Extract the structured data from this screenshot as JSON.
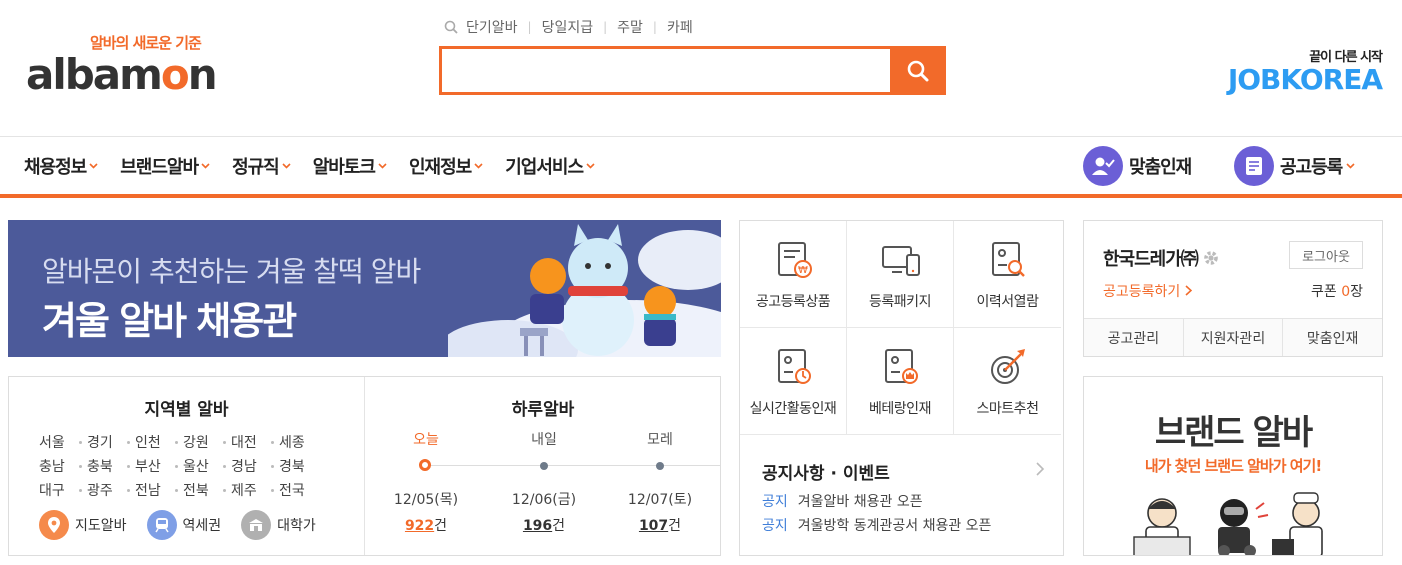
{
  "header": {
    "logo_slogan": "알바의 새로운 기준",
    "logo_text": "albamon",
    "quick_links": [
      "단기알바",
      "당일지급",
      "주말",
      "카페"
    ],
    "search_placeholder": "",
    "jobkorea_slogan": "끝이 다른 시작",
    "jobkorea_text": "JOBKOREA"
  },
  "nav": {
    "items": [
      "채용정보",
      "브랜드알바",
      "정규직",
      "알바토크",
      "인재정보",
      "기업서비스"
    ],
    "matching": "맞춤인재",
    "post": "공고등록"
  },
  "banner": {
    "subtitle": "알바몬이 추천하는 겨울 찰떡 알바",
    "title": "겨울 알바 채용관"
  },
  "region": {
    "title": "지역별 알바",
    "rows": [
      [
        "서울",
        "경기",
        "인천",
        "강원",
        "대전",
        "세종"
      ],
      [
        "충남",
        "충북",
        "부산",
        "울산",
        "경남",
        "경북"
      ],
      [
        "대구",
        "광주",
        "전남",
        "전북",
        "제주",
        "전국"
      ]
    ],
    "links": [
      "지도알바",
      "역세권",
      "대학가"
    ]
  },
  "daily": {
    "title": "하루알바",
    "days": [
      {
        "label": "오늘",
        "date": "12/05(목)",
        "count": "922",
        "unit": "건"
      },
      {
        "label": "내일",
        "date": "12/06(금)",
        "count": "196",
        "unit": "건"
      },
      {
        "label": "모레",
        "date": "12/07(토)",
        "count": "107",
        "unit": "건"
      }
    ]
  },
  "services": {
    "items": [
      "공고등록상품",
      "등록패키지",
      "이력서열람",
      "실시간활동인재",
      "베테랑인재",
      "스마트추천"
    ],
    "notice_title": "공지사항 · 이벤트",
    "notices": [
      {
        "tag": "공지",
        "text": "겨울알바 채용관 오픈"
      },
      {
        "tag": "공지",
        "text": "겨울방학 동계관공서 채용관 오픈"
      }
    ]
  },
  "login": {
    "company": "한국드레가㈜",
    "logout": "로그아웃",
    "post_link": "공고등록하기",
    "coupon_label": "쿠폰",
    "coupon_count": "0",
    "coupon_unit": "장",
    "tabs": [
      "공고관리",
      "지원자관리",
      "맞춤인재"
    ]
  },
  "brand": {
    "title": "브랜드 알바",
    "subtitle": "내가 찾던 브랜드 알바가 여기!"
  },
  "colors": {
    "accent": "#f26a2a",
    "banner_bg": "#4c5a9a",
    "jobkorea": "#2d9cf2",
    "nav_icon": "#6b5fd6",
    "notice_tag": "#3f7ed8"
  }
}
